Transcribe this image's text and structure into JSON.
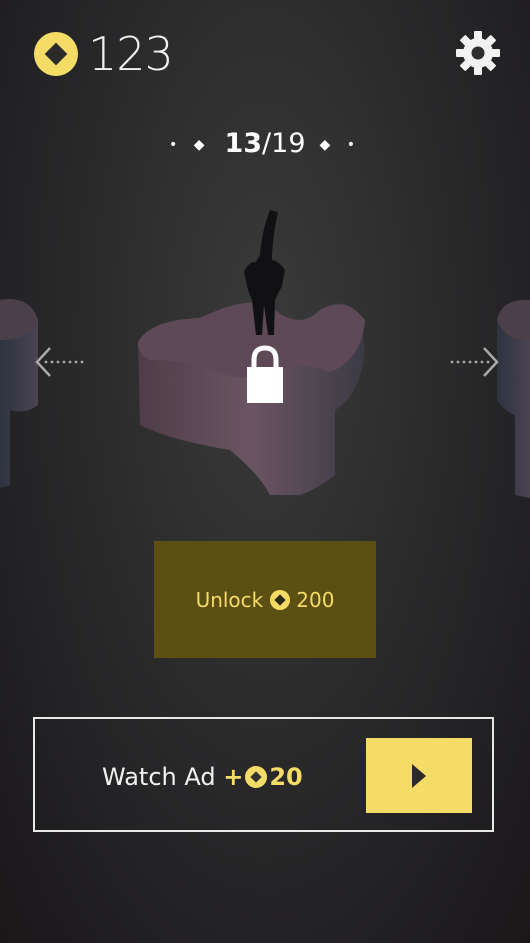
{
  "hud": {
    "coins": "123",
    "coin_icon": "coin-icon",
    "settings_icon": "gear-icon"
  },
  "level": {
    "current": "13",
    "separator": "/",
    "total": "19",
    "left_decor": "• ◆",
    "right_decor": "◆ •"
  },
  "navigation": {
    "prev_icon": "arrow-left-icon",
    "next_icon": "arrow-right-icon"
  },
  "unlock": {
    "label": "Unlock",
    "cost": "200",
    "lock_icon": "lock-icon"
  },
  "watch_ad": {
    "label": "Watch Ad",
    "plus": "+",
    "reward": "20",
    "play_icon": "play-icon"
  },
  "colors": {
    "accent": "#f4dc66",
    "unlock_bg": "#5b4f12",
    "background": "#2b2b2c"
  }
}
